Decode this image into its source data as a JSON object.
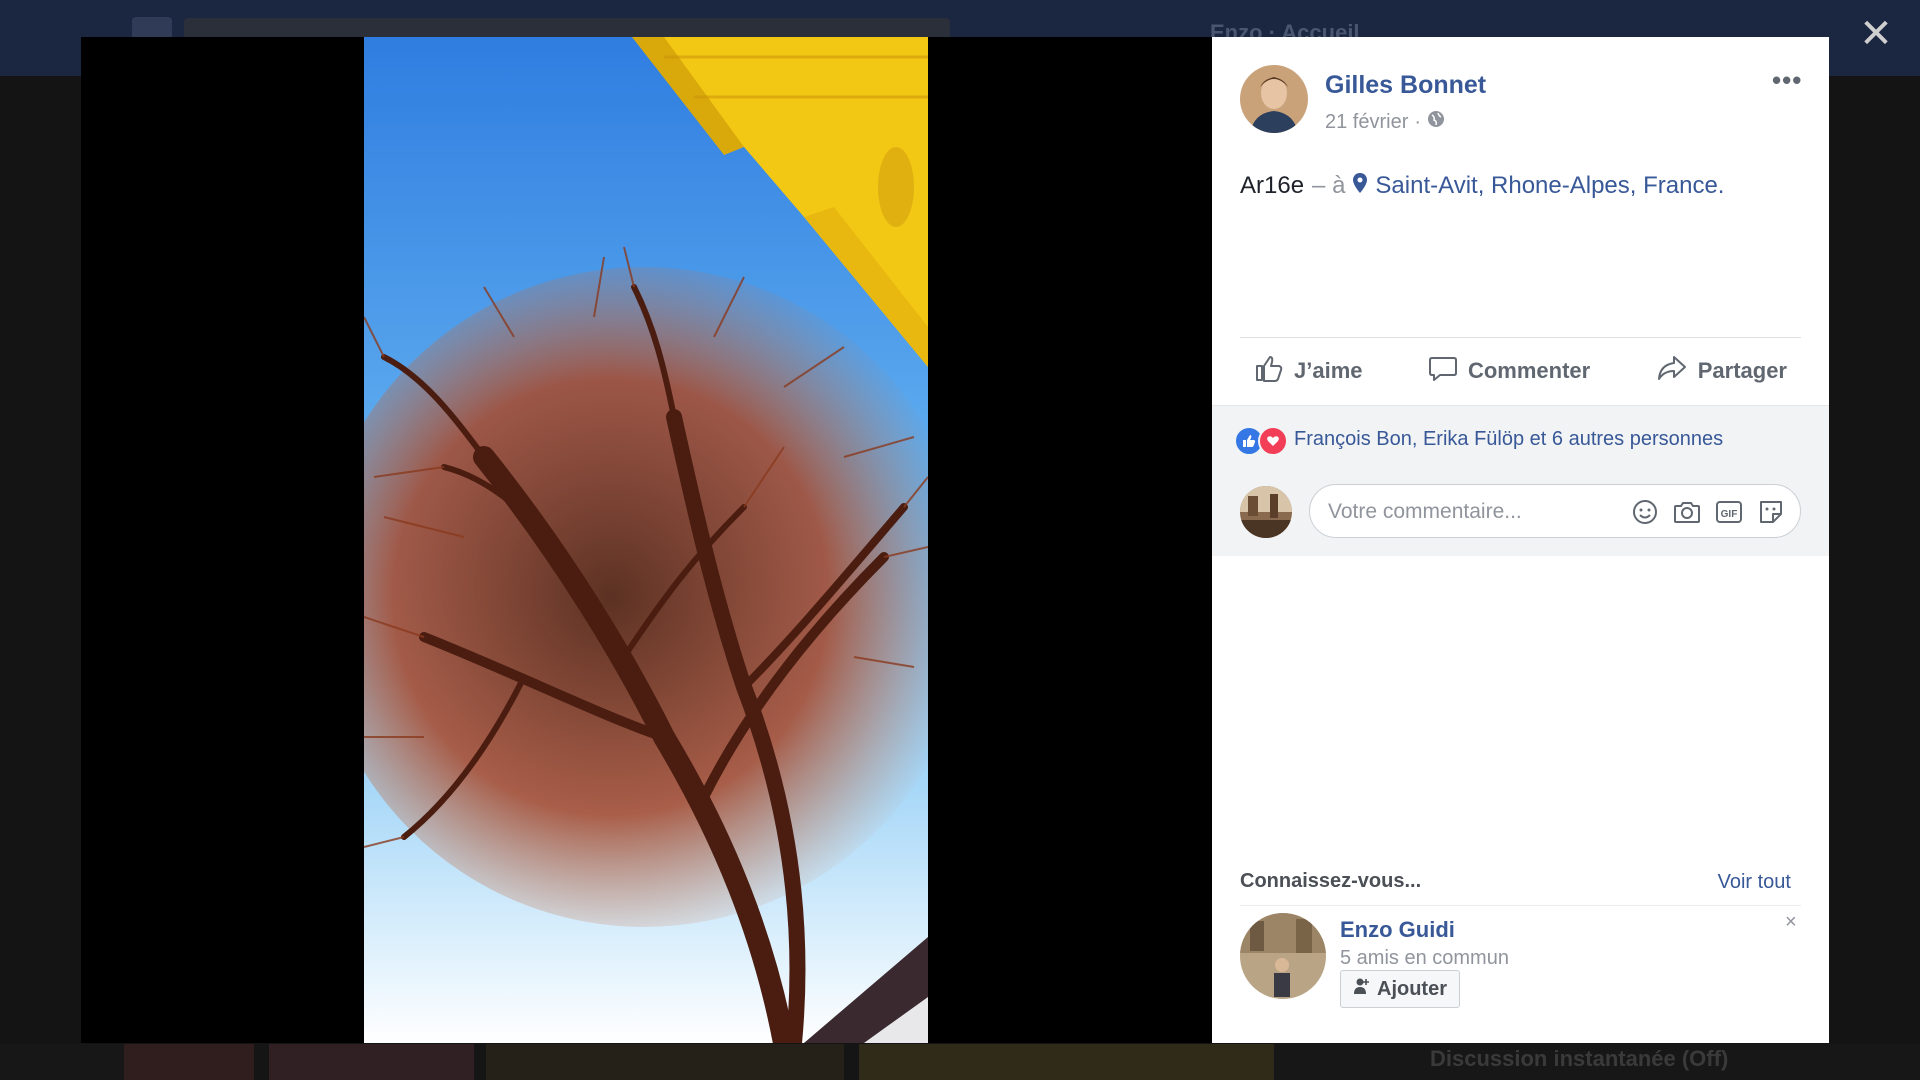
{
  "background": {
    "top_right_text": "Enzo  ·  Accueil",
    "chat_bar_label": "Discussion instantanée (Off)"
  },
  "viewer": {
    "close_icon": "close-icon",
    "photo_description_icon": "photo"
  },
  "post": {
    "author": "Gilles Bonnet",
    "date": "21 février",
    "privacy_icon": "globe-icon",
    "more_label": "•••",
    "text": "Ar16e",
    "separator": "– à",
    "location": "Saint-Avit, Rhone-Alpes, France."
  },
  "actions": {
    "like": "J’aime",
    "comment": "Commenter",
    "share": "Partager"
  },
  "likes": {
    "text": "François Bon, Erika Fülöp et 6 autres personnes",
    "reaction_icons": [
      "like-icon",
      "love-icon"
    ]
  },
  "comment": {
    "placeholder": "Votre commentaire...",
    "icons": [
      "emoji-icon",
      "camera-icon",
      "gif-icon",
      "sticker-icon"
    ]
  },
  "suggestions": {
    "title": "Connaissez-vous...",
    "see_all": "Voir tout",
    "friend": {
      "name": "Enzo Guidi",
      "mutual": "5 amis en commun",
      "add_label": "Ajouter",
      "dismiss": "×"
    }
  },
  "colors": {
    "link": "#385898",
    "sky": "#5ea8ee",
    "building": "#f5d21c",
    "tree": "#b5542e"
  }
}
